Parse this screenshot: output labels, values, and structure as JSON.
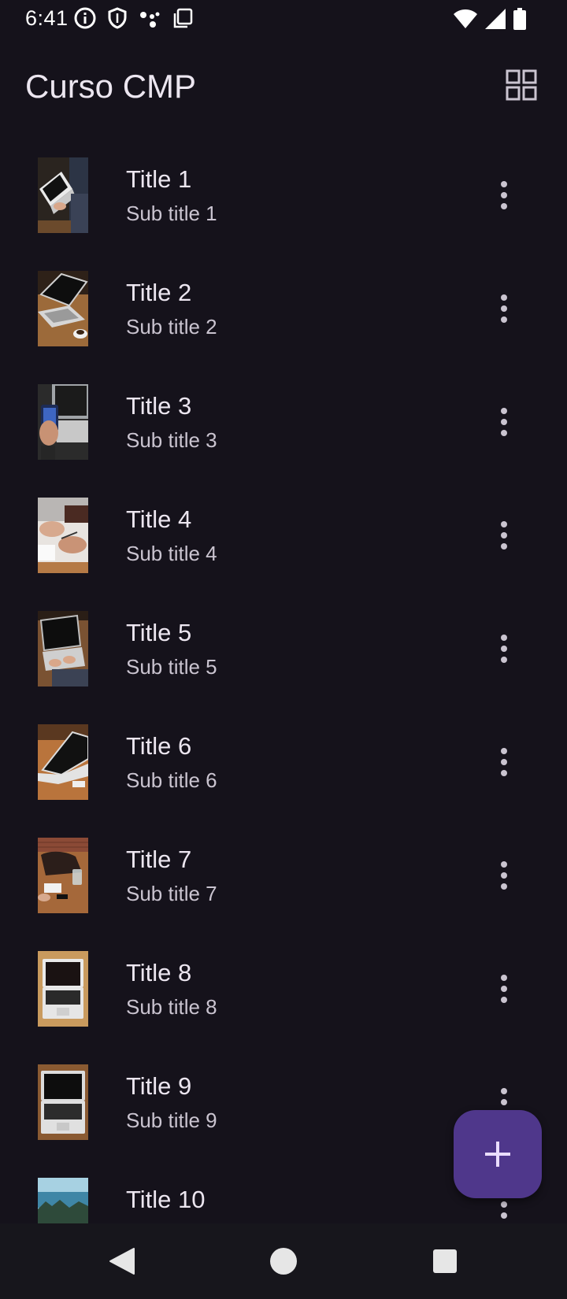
{
  "status_bar": {
    "time": "6:41",
    "left_icons": [
      "info-icon",
      "shield-icon",
      "assistant-dots-icon",
      "copy-icon"
    ],
    "right_icons": [
      "wifi-icon",
      "signal-icon",
      "battery-icon"
    ]
  },
  "app_bar": {
    "title": "Curso CMP",
    "action_icon": "grid-view-icon"
  },
  "list": {
    "items": [
      {
        "title": "Title 1",
        "subtitle": "Sub title 1",
        "image": "laptop-typing-photo"
      },
      {
        "title": "Title 2",
        "subtitle": "Sub title 2",
        "image": "laptop-coffee-photo"
      },
      {
        "title": "Title 3",
        "subtitle": "Sub title 3",
        "image": "phone-laptop-photo"
      },
      {
        "title": "Title 4",
        "subtitle": "Sub title 4",
        "image": "writing-hands-photo"
      },
      {
        "title": "Title 5",
        "subtitle": "Sub title 5",
        "image": "laptop-typing-photo"
      },
      {
        "title": "Title 6",
        "subtitle": "Sub title 6",
        "image": "laptop-desk-photo"
      },
      {
        "title": "Title 7",
        "subtitle": "Sub title 7",
        "image": "desk-brick-wall-photo"
      },
      {
        "title": "Title 8",
        "subtitle": "Sub title 8",
        "image": "laptop-topdown-photo"
      },
      {
        "title": "Title 9",
        "subtitle": "Sub title 9",
        "image": "laptop-topdown-photo"
      },
      {
        "title": "Title 10",
        "subtitle": "",
        "image": "sea-landscape-photo"
      }
    ],
    "more_icon": "more-vert-icon"
  },
  "fab": {
    "icon": "add-icon",
    "color": "#4f378b"
  },
  "nav_bar": {
    "icons": [
      "back-icon",
      "home-icon",
      "recents-icon"
    ]
  },
  "colors": {
    "background": "#15121b",
    "text_primary": "#ece6f0",
    "text_secondary": "#cac4d0",
    "nav_background": "#17161c"
  }
}
